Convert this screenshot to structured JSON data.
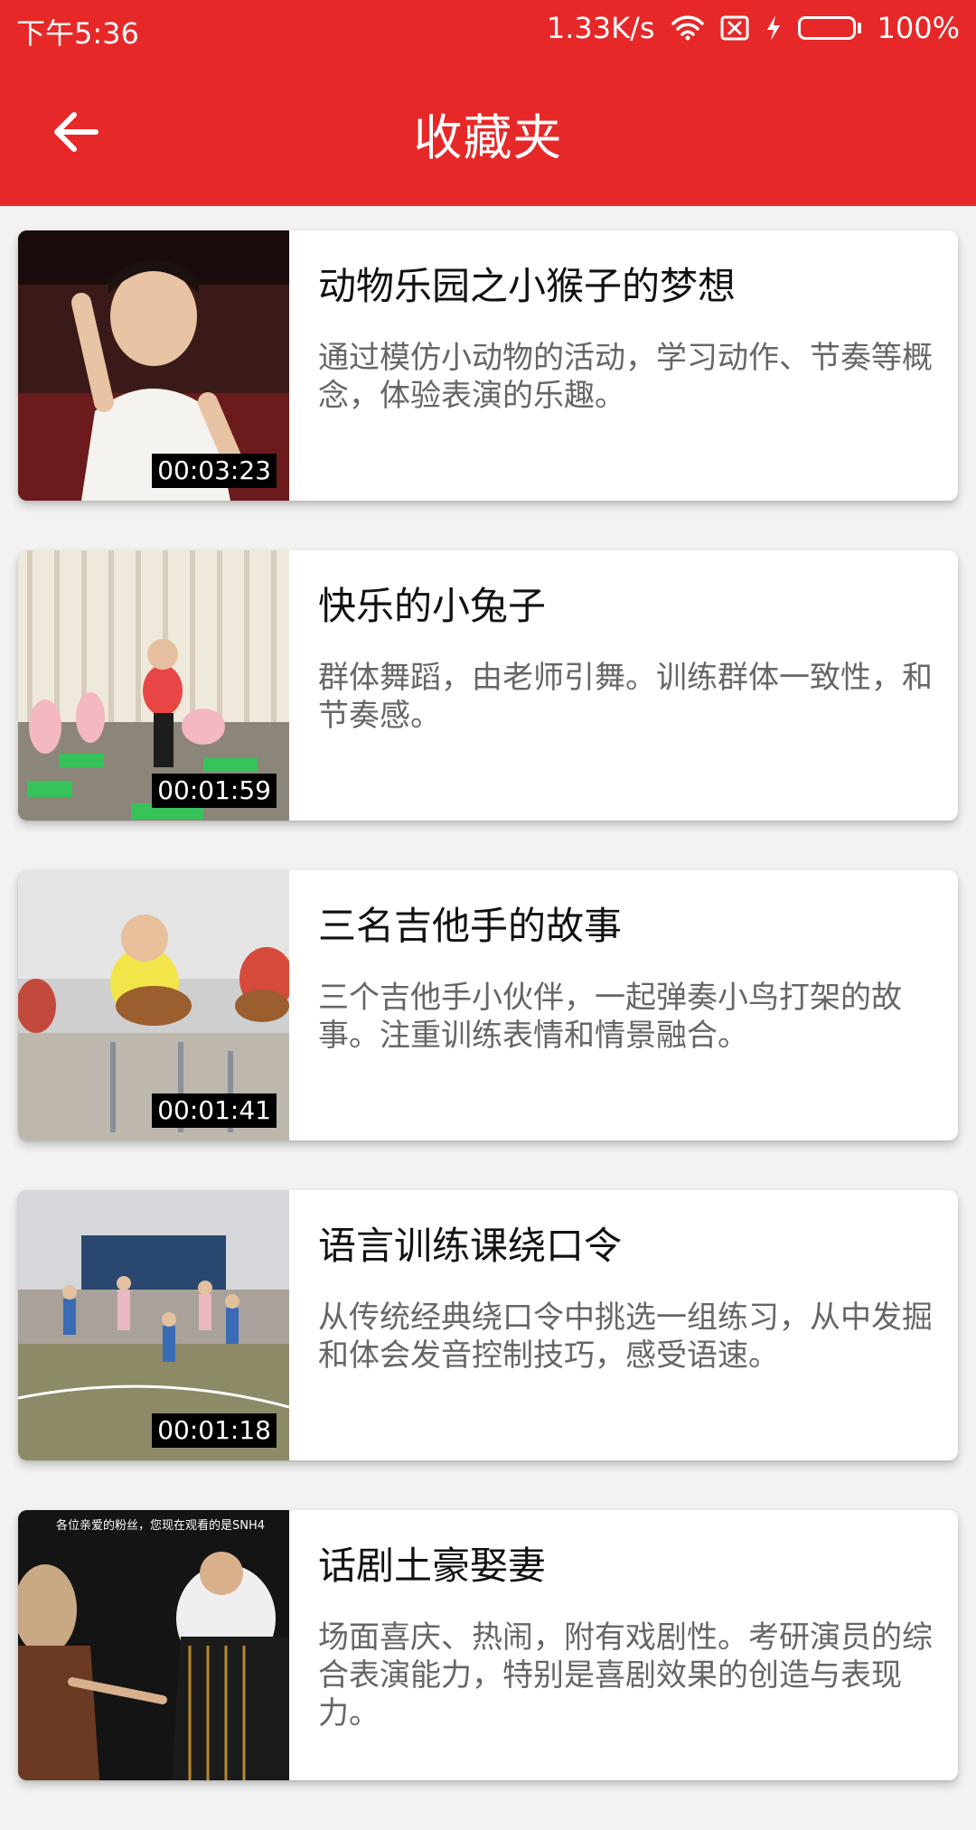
{
  "status": {
    "time": "下午5:36",
    "speed": "1.33K/s",
    "battery": "100%",
    "battery_level": 1.0,
    "battery_color": "#31d40f"
  },
  "header": {
    "title": "收藏夹",
    "color": "#e62828"
  },
  "videos": [
    {
      "title": "动物乐园之小猴子的梦想",
      "description": "通过模仿小动物的活动，学习动作、节奏等概念，体验表演的乐趣。",
      "duration": "00:03:23"
    },
    {
      "title": "快乐的小兔子",
      "description": "群体舞蹈，由老师引舞。训练群体一致性，和节奏感。",
      "duration": "00:01:59"
    },
    {
      "title": "三名吉他手的故事",
      "description": "三个吉他手小伙伴，一起弹奏小鸟打架的故事。注重训练表情和情景融合。",
      "duration": "00:01:41"
    },
    {
      "title": "语言训练课绕口令",
      "description": "从传统经典绕口令中挑选一组练习，从中发掘和体会发音控制技巧，感受语速。",
      "duration": "00:01:18"
    },
    {
      "title": "话剧土豪娶妻",
      "description": "场面喜庆、热闹，附有戏剧性。考研演员的综合表演能力，特别是喜剧效果的创造与表现力。",
      "duration": "",
      "thumbnail_caption": "各位亲爱的粉丝，您现在观看的是SNH4"
    }
  ]
}
